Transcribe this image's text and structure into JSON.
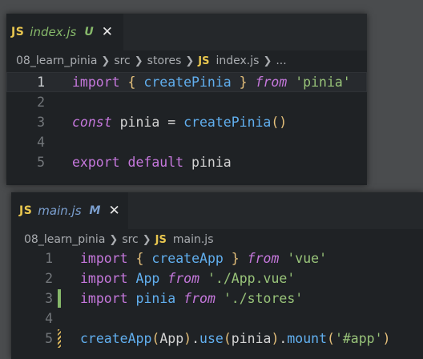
{
  "colors": {
    "background": "#4a4c4e",
    "editor_bg": "#1f2225",
    "js_badge": "#e8c64f",
    "untracked": "#86b86a",
    "modified": "#7b9fcf",
    "keyword": "#c678dd",
    "function": "#61afef",
    "string": "#98c379",
    "gutter_added": "#86b86a",
    "gutter_modified": "#d4b15a"
  },
  "editors": [
    {
      "tab": {
        "icon": "JS",
        "filename": "index.js",
        "status": "U",
        "status_color": "#86b86a",
        "close": "✕"
      },
      "breadcrumb": {
        "items": [
          "08_learn_pinia",
          "src",
          "stores"
        ],
        "file_icon": "JS",
        "file": "index.js",
        "trailing": "..."
      },
      "lines": [
        {
          "number": "1",
          "highlight": true,
          "gutter": "",
          "tokens": [
            {
              "t": "import",
              "c": "kw"
            },
            {
              "t": " ",
              "c": "id"
            },
            {
              "t": "{",
              "c": "br1"
            },
            {
              "t": " ",
              "c": "id"
            },
            {
              "t": "createPinia",
              "c": "fn"
            },
            {
              "t": " ",
              "c": "id"
            },
            {
              "t": "}",
              "c": "br1"
            },
            {
              "t": " ",
              "c": "id"
            },
            {
              "t": "from",
              "c": "kwi"
            },
            {
              "t": " ",
              "c": "id"
            },
            {
              "t": "'pinia'",
              "c": "str"
            }
          ]
        },
        {
          "number": "2",
          "highlight": false,
          "gutter": "",
          "tokens": []
        },
        {
          "number": "3",
          "highlight": false,
          "gutter": "",
          "tokens": [
            {
              "t": "const",
              "c": "kwi"
            },
            {
              "t": " pinia ",
              "c": "id"
            },
            {
              "t": "=",
              "c": "punc"
            },
            {
              "t": " ",
              "c": "id"
            },
            {
              "t": "createPinia",
              "c": "fn"
            },
            {
              "t": "()",
              "c": "br1"
            }
          ]
        },
        {
          "number": "4",
          "highlight": false,
          "gutter": "",
          "tokens": []
        },
        {
          "number": "5",
          "highlight": false,
          "gutter": "",
          "tokens": [
            {
              "t": "export",
              "c": "kw"
            },
            {
              "t": " ",
              "c": "id"
            },
            {
              "t": "default",
              "c": "kw"
            },
            {
              "t": " pinia",
              "c": "id"
            }
          ]
        }
      ]
    },
    {
      "tab": {
        "icon": "JS",
        "filename": "main.js",
        "status": "M",
        "status_color": "#7b9fcf",
        "close": "✕"
      },
      "breadcrumb": {
        "items": [
          "08_learn_pinia",
          "src"
        ],
        "file_icon": "JS",
        "file": "main.js",
        "trailing": ""
      },
      "lines": [
        {
          "number": "1",
          "highlight": false,
          "gutter": "",
          "tokens": [
            {
              "t": "import",
              "c": "kw"
            },
            {
              "t": " ",
              "c": "id"
            },
            {
              "t": "{",
              "c": "br1"
            },
            {
              "t": " ",
              "c": "id"
            },
            {
              "t": "createApp",
              "c": "fn"
            },
            {
              "t": " ",
              "c": "id"
            },
            {
              "t": "}",
              "c": "br1"
            },
            {
              "t": " ",
              "c": "id"
            },
            {
              "t": "from",
              "c": "kwi"
            },
            {
              "t": " ",
              "c": "id"
            },
            {
              "t": "'vue'",
              "c": "str"
            }
          ]
        },
        {
          "number": "2",
          "highlight": false,
          "gutter": "",
          "tokens": [
            {
              "t": "import",
              "c": "kw"
            },
            {
              "t": " ",
              "c": "id"
            },
            {
              "t": "App",
              "c": "fn"
            },
            {
              "t": " ",
              "c": "id"
            },
            {
              "t": "from",
              "c": "kwi"
            },
            {
              "t": " ",
              "c": "id"
            },
            {
              "t": "'./App.vue'",
              "c": "str"
            }
          ]
        },
        {
          "number": "3",
          "highlight": false,
          "gutter": "added",
          "tokens": [
            {
              "t": "import",
              "c": "kw"
            },
            {
              "t": " ",
              "c": "id"
            },
            {
              "t": "pinia",
              "c": "fn"
            },
            {
              "t": " ",
              "c": "id"
            },
            {
              "t": "from",
              "c": "kwi"
            },
            {
              "t": " ",
              "c": "id"
            },
            {
              "t": "'./stores'",
              "c": "str"
            }
          ]
        },
        {
          "number": "4",
          "highlight": false,
          "gutter": "",
          "tokens": []
        },
        {
          "number": "5",
          "highlight": false,
          "gutter": "modified",
          "tokens": [
            {
              "t": "createApp",
              "c": "fn"
            },
            {
              "t": "(",
              "c": "br1"
            },
            {
              "t": "App",
              "c": "id"
            },
            {
              "t": ")",
              "c": "br1"
            },
            {
              "t": ".",
              "c": "punc"
            },
            {
              "t": "use",
              "c": "fn"
            },
            {
              "t": "(",
              "c": "br1"
            },
            {
              "t": "pinia",
              "c": "id"
            },
            {
              "t": ")",
              "c": "br1"
            },
            {
              "t": ".",
              "c": "punc"
            },
            {
              "t": "mount",
              "c": "fn"
            },
            {
              "t": "(",
              "c": "br1"
            },
            {
              "t": "'#app'",
              "c": "str"
            },
            {
              "t": ")",
              "c": "br1"
            }
          ]
        }
      ]
    }
  ]
}
